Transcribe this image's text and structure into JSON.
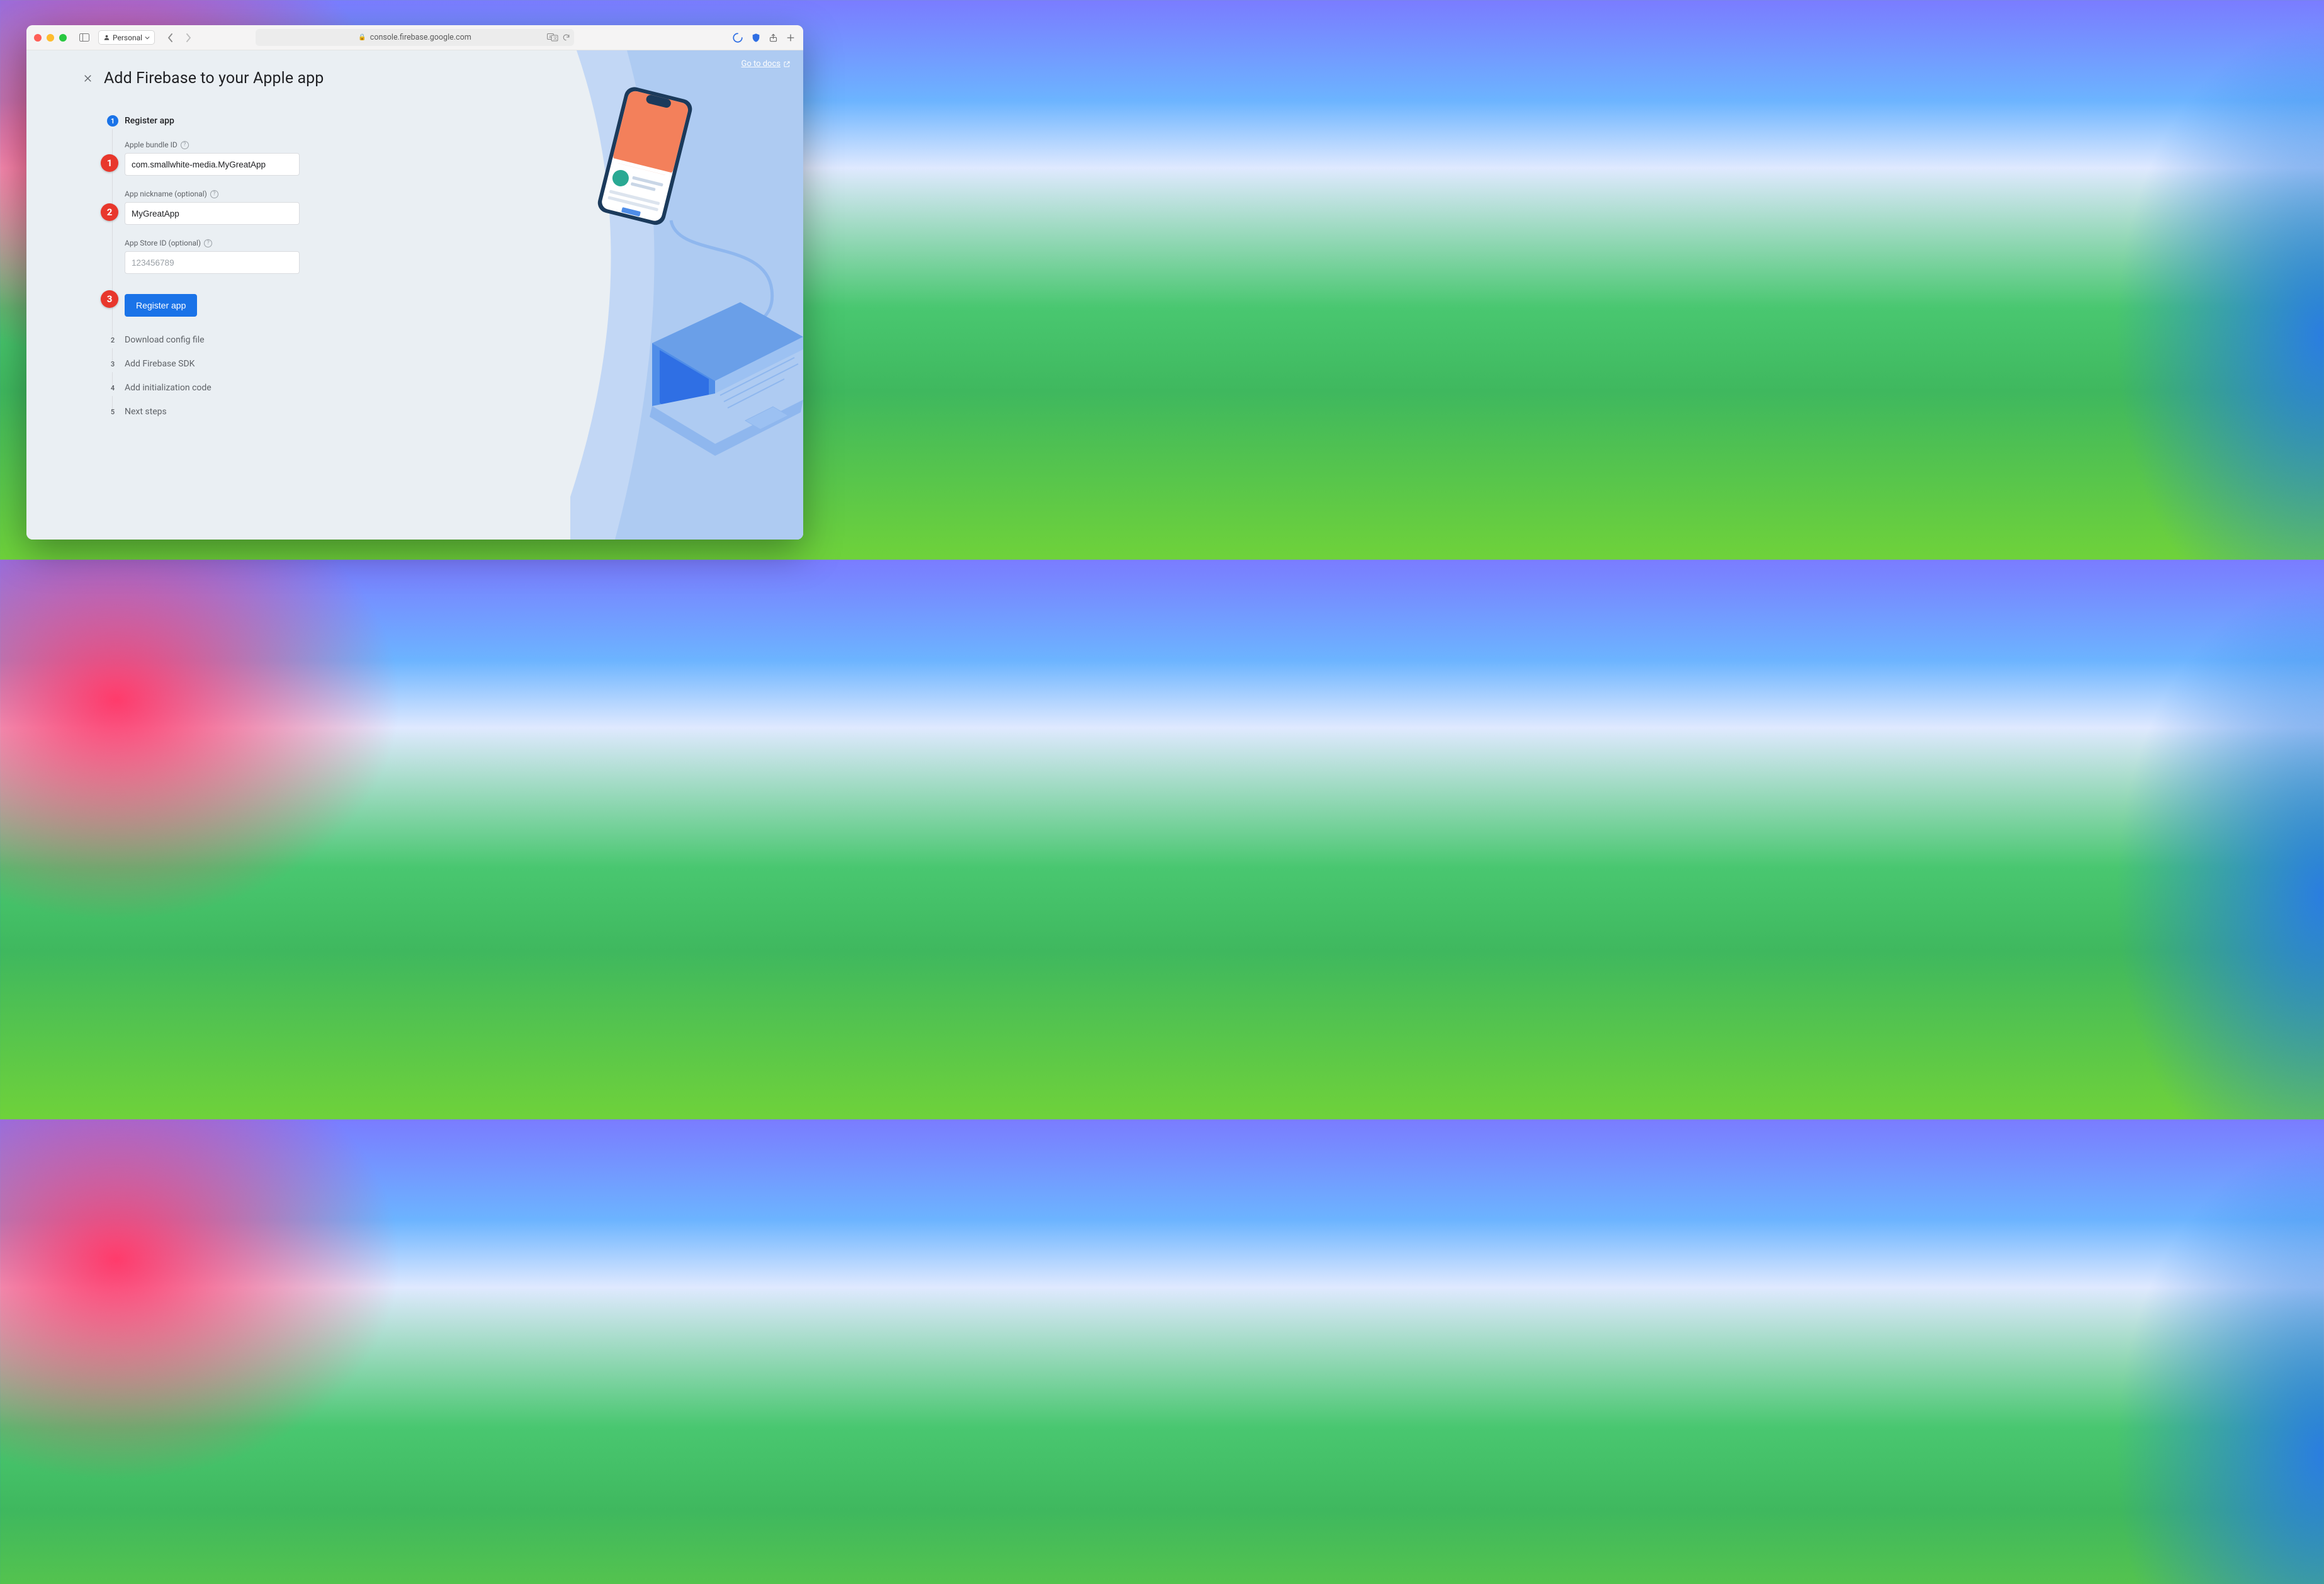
{
  "browser": {
    "profile_label": "Personal",
    "address": "console.firebase.google.com"
  },
  "docs_link": "Go to docs",
  "page_title": "Add Firebase to your Apple app",
  "steps": [
    {
      "title": "Register app",
      "active": true
    },
    {
      "title": "Download config file",
      "active": false
    },
    {
      "title": "Add Firebase SDK",
      "active": false
    },
    {
      "title": "Add initialization code",
      "active": false
    },
    {
      "title": "Next steps",
      "active": false
    }
  ],
  "fields": {
    "bundle_id": {
      "label": "Apple bundle ID",
      "value": "com.smallwhite-media.MyGreatApp"
    },
    "nickname": {
      "label": "App nickname (optional)",
      "value": "MyGreatApp"
    },
    "app_store": {
      "label": "App Store ID (optional)",
      "placeholder": "123456789",
      "value": ""
    }
  },
  "register_button": "Register app",
  "annotations": {
    "a1": "1",
    "a2": "2",
    "a3": "3"
  }
}
